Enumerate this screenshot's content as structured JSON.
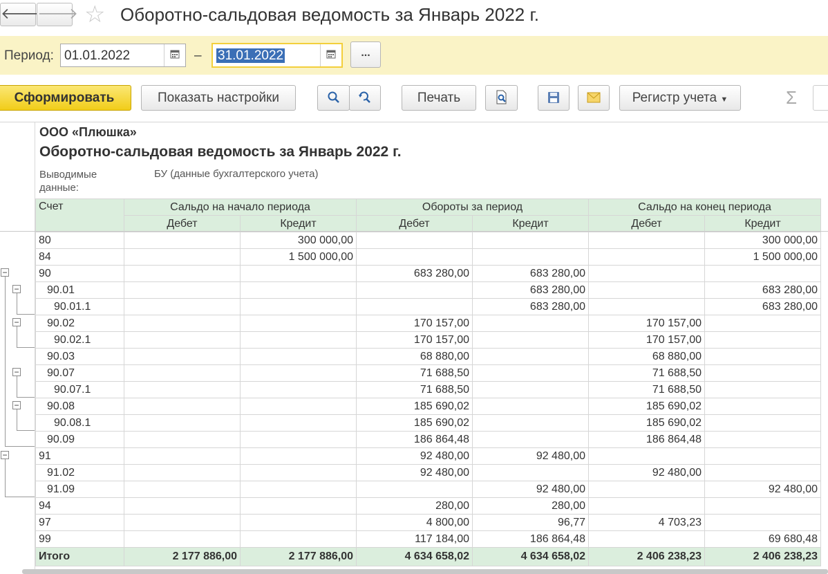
{
  "window": {
    "title": "Оборотно-сальдовая ведомость за Январь 2022 г."
  },
  "period": {
    "label": "Период:",
    "from": "01.01.2022",
    "to": "31.01.2022",
    "dash": "–",
    "more_label": "..."
  },
  "toolbar": {
    "generate": "Сформировать",
    "show_settings": "Показать настройки",
    "print": "Печать",
    "register": "Регистр учета"
  },
  "report": {
    "organization": "ООО «Плюшка»",
    "title": "Оборотно-сальдовая ведомость за Январь 2022 г.",
    "output_label": "Выводимые данные:",
    "output_value": "БУ (данные бухгалтерского учета)",
    "columns": {
      "account": "Счет",
      "opening": "Сальдо на начало периода",
      "turnover": "Обороты за период",
      "closing": "Сальдо на конец периода",
      "debit": "Дебет",
      "credit": "Кредит"
    },
    "rows": [
      {
        "account": "80",
        "indent": 0,
        "od": "",
        "oc": "300 000,00",
        "td": "",
        "tc": "",
        "cd": "",
        "cc": "300 000,00"
      },
      {
        "account": "84",
        "indent": 0,
        "od": "",
        "oc": "1 500 000,00",
        "td": "",
        "tc": "",
        "cd": "",
        "cc": "1 500 000,00"
      },
      {
        "account": "90",
        "indent": 0,
        "od": "",
        "oc": "",
        "td": "683 280,00",
        "tc": "683 280,00",
        "cd": "",
        "cc": ""
      },
      {
        "account": "90.01",
        "indent": 1,
        "od": "",
        "oc": "",
        "td": "",
        "tc": "683 280,00",
        "cd": "",
        "cc": "683 280,00"
      },
      {
        "account": "90.01.1",
        "indent": 2,
        "od": "",
        "oc": "",
        "td": "",
        "tc": "683 280,00",
        "cd": "",
        "cc": "683 280,00"
      },
      {
        "account": "90.02",
        "indent": 1,
        "od": "",
        "oc": "",
        "td": "170 157,00",
        "tc": "",
        "cd": "170 157,00",
        "cc": ""
      },
      {
        "account": "90.02.1",
        "indent": 2,
        "od": "",
        "oc": "",
        "td": "170 157,00",
        "tc": "",
        "cd": "170 157,00",
        "cc": ""
      },
      {
        "account": "90.03",
        "indent": 1,
        "od": "",
        "oc": "",
        "td": "68 880,00",
        "tc": "",
        "cd": "68 880,00",
        "cc": ""
      },
      {
        "account": "90.07",
        "indent": 1,
        "od": "",
        "oc": "",
        "td": "71 688,50",
        "tc": "",
        "cd": "71 688,50",
        "cc": ""
      },
      {
        "account": "90.07.1",
        "indent": 2,
        "od": "",
        "oc": "",
        "td": "71 688,50",
        "tc": "",
        "cd": "71 688,50",
        "cc": ""
      },
      {
        "account": "90.08",
        "indent": 1,
        "od": "",
        "oc": "",
        "td": "185 690,02",
        "tc": "",
        "cd": "185 690,02",
        "cc": ""
      },
      {
        "account": "90.08.1",
        "indent": 2,
        "od": "",
        "oc": "",
        "td": "185 690,02",
        "tc": "",
        "cd": "185 690,02",
        "cc": ""
      },
      {
        "account": "90.09",
        "indent": 1,
        "od": "",
        "oc": "",
        "td": "186 864,48",
        "tc": "",
        "cd": "186 864,48",
        "cc": ""
      },
      {
        "account": "91",
        "indent": 0,
        "od": "",
        "oc": "",
        "td": "92 480,00",
        "tc": "92 480,00",
        "cd": "",
        "cc": ""
      },
      {
        "account": "91.02",
        "indent": 1,
        "od": "",
        "oc": "",
        "td": "92 480,00",
        "tc": "",
        "cd": "92 480,00",
        "cc": ""
      },
      {
        "account": "91.09",
        "indent": 1,
        "od": "",
        "oc": "",
        "td": "",
        "tc": "92 480,00",
        "cd": "",
        "cc": "92 480,00"
      },
      {
        "account": "94",
        "indent": 0,
        "od": "",
        "oc": "",
        "td": "280,00",
        "tc": "280,00",
        "cd": "",
        "cc": ""
      },
      {
        "account": "97",
        "indent": 0,
        "od": "",
        "oc": "",
        "td": "4 800,00",
        "tc": "96,77",
        "cd": "4 703,23",
        "cc": ""
      },
      {
        "account": "99",
        "indent": 0,
        "od": "",
        "oc": "",
        "td": "117 184,00",
        "tc": "186 864,48",
        "cd": "",
        "cc": "69 680,48"
      }
    ],
    "total": {
      "account": "Итого",
      "od": "2 177 886,00",
      "oc": "2 177 886,00",
      "td": "4 634 658,02",
      "tc": "4 634 658,02",
      "cd": "2 406 238,23",
      "cc": "2 406 238,23"
    }
  },
  "icons": {
    "back": "arrow-left-icon",
    "forward": "arrow-right-icon",
    "favorite": "star-icon",
    "calendar": "calendar-icon",
    "search": "search-icon",
    "search_refresh": "search-refresh-icon",
    "preview": "print-preview-icon",
    "save": "floppy-disk-icon",
    "mail": "envelope-icon",
    "sum": "sigma-icon"
  },
  "colors": {
    "period_bar": "#faf3c6",
    "primary_button": "#f1cd19",
    "header_fill": "#dbeedd",
    "selection": "#3b6fb6"
  }
}
